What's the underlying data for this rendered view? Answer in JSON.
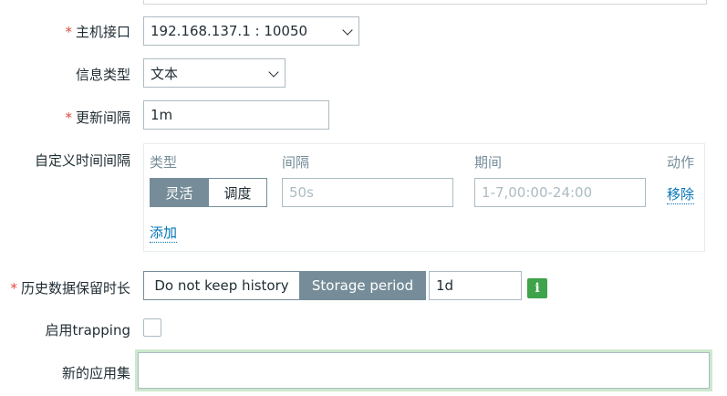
{
  "form": {
    "host_interface": {
      "label": "主机接口",
      "required": true,
      "value": "192.168.137.1 : 10050"
    },
    "info_type": {
      "label": "信息类型",
      "required": false,
      "value": "文本"
    },
    "update_interval": {
      "label": "更新间隔",
      "required": true,
      "value": "1m"
    },
    "custom_intervals": {
      "label": "自定义时间间隔",
      "columns": {
        "type": "类型",
        "interval": "间隔",
        "period": "期间",
        "action": "动作"
      },
      "type_options": [
        "灵活",
        "调度"
      ],
      "active_type": "灵活",
      "interval_placeholder": "50s",
      "period_placeholder": "1-7,00:00-24:00",
      "remove_label": "移除",
      "add_label": "添加"
    },
    "history": {
      "label": "历史数据保留时长",
      "required": true,
      "options": [
        "Do not keep history",
        "Storage period"
      ],
      "active": "Storage period",
      "value": "1d",
      "info_icon": "i"
    },
    "trapping": {
      "label": "启用trapping",
      "checked": false
    },
    "new_application": {
      "label": "新的应用集",
      "value": ""
    }
  },
  "colors": {
    "accent_link": "#0275b8",
    "segment_active": "#768d99",
    "required_star": "#e0483e",
    "info_green": "#3ea34b",
    "focus_glow": "#cde8cd"
  }
}
